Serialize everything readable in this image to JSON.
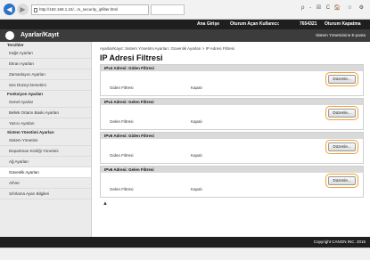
{
  "browser": {
    "back_icon": "arrow-left-icon",
    "forward_icon": "arrow-right-icon",
    "url": "http://192.168.1.24/...m_security_ipfilter.html",
    "tools": "ρ - ☒ C",
    "tab_title": "",
    "window_controls": "🏠 ☆ ⚙"
  },
  "topbar": {
    "items": [
      "Ana Girişe",
      "Oturum Açan Kullanıcı:",
      "7654321",
      "Oturum Kapatma"
    ]
  },
  "header": {
    "logo_icon": "canon-logo-icon",
    "logo_char": "",
    "title": "Ayarlar/Kayıt",
    "sys_link": "Sistem Yöneticisine E-posta"
  },
  "sidebar": {
    "sections": [
      {
        "title": "Tercihler",
        "items": [
          "Kağıt Ayarları",
          "Ekran Ayarları",
          "Zamanlayıcı Ayarları",
          "Ses Düzeyi Denetimi"
        ]
      },
      {
        "title": "Fonksiyon Ayarları",
        "items": [
          "Genel Ayarlar",
          "Bellek Ortamı Baskı Ayarları",
          "Yazıcı Ayarları"
        ]
      },
      {
        "title": "Sistem Yönetimi Ayarları",
        "items": [
          "Sistem Yönetimi",
          "Departman Kimliği Yönetimi",
          "Ağ Ayarları",
          "Güvenlik Ayarları",
          "Al/Ver",
          "Sıfırlama Ayarı Bilgileri"
        ]
      }
    ],
    "active_item": "Güvenlik Ayarları"
  },
  "main": {
    "breadcrumb": "Ayarlar/Kayıt: Sistem Yönetimi Ayarları: Güvenlik Ayarları > IP Adresi Filtresi",
    "title": "IP Adresi Filtresi",
    "panels": [
      {
        "header": "IPv4 Adresi: Giden Filtresi",
        "label": "Giden Filtresi",
        "value": "Kapalı",
        "button": "Düzenle..."
      },
      {
        "header": "IPv4 Adresi: Gelen Filtresi",
        "label": "Gelen Filtresi",
        "value": "Kapalı",
        "button": "Düzenle..."
      },
      {
        "header": "IPv6 Adresi: Giden Filtresi",
        "label": "Giden Filtresi",
        "value": "Kapalı",
        "button": "Düzenle..."
      },
      {
        "header": "IPv6 Adresi: Gelen Filtresi",
        "label": "Gelen Filtresi",
        "value": "Kapalı",
        "button": "Düzenle..."
      }
    ],
    "to_top_icon": "up-triangle-icon",
    "to_top_char": "▲"
  },
  "footer": {
    "copyright": "Copyright CANON INC. 2015"
  },
  "colors": {
    "topbar": "#1f1f1f",
    "header": "#3c3c3c",
    "sidebar": "#ebebeb",
    "highlight": "#f0a030",
    "browser_back": "#2a73c7"
  }
}
